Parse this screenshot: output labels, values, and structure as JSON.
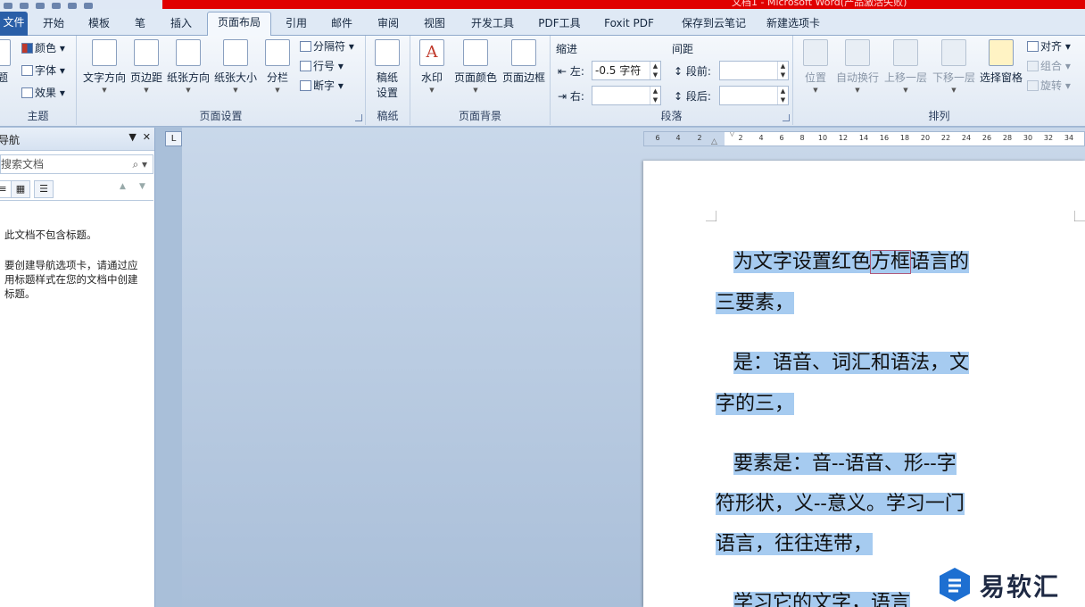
{
  "window": {
    "title": "文档1 - Microsoft Word(产品激活失败)"
  },
  "tabs": [
    {
      "label": "文件"
    },
    {
      "label": "开始"
    },
    {
      "label": "模板"
    },
    {
      "label": "笔"
    },
    {
      "label": "插入"
    },
    {
      "label": "页面布局"
    },
    {
      "label": "引用"
    },
    {
      "label": "邮件"
    },
    {
      "label": "审阅"
    },
    {
      "label": "视图"
    },
    {
      "label": "开发工具"
    },
    {
      "label": "PDF工具"
    },
    {
      "label": "Foxit PDF"
    },
    {
      "label": "保存到云笔记"
    },
    {
      "label": "新建选项卡"
    }
  ],
  "ribbon": {
    "theme": {
      "label": "主题",
      "theme_btn": "题",
      "colors": "颜色",
      "fonts": "字体",
      "effects": "效果"
    },
    "page_setup": {
      "label": "页面设置",
      "text_direction": "文字方向",
      "margins": "页边距",
      "orientation": "纸张方向",
      "size": "纸张大小",
      "columns": "分栏",
      "breaks": "分隔符",
      "line_numbers": "行号",
      "hyphenation": "断字"
    },
    "manuscript": {
      "label": "稿纸",
      "setup_line1": "稿纸",
      "setup_line2": "设置"
    },
    "page_background": {
      "label": "页面背景",
      "watermark": "水印",
      "page_color": "页面颜色",
      "page_borders": "页面边框"
    },
    "paragraph": {
      "label": "段落",
      "indent_title": "缩进",
      "spacing_title": "间距",
      "indent_left_label": "左:",
      "indent_left_value": "-0.5 字符",
      "indent_right_label": "右:",
      "indent_right_value": "",
      "spacing_before_label": "段前:",
      "spacing_before_value": "",
      "spacing_after_label": "段后:",
      "spacing_after_value": ""
    },
    "arrange": {
      "label": "排列",
      "position": "位置",
      "wrap_text": "自动换行",
      "bring_forward": "上移一层",
      "send_backward": "下移一层",
      "selection_pane": "选择窗格",
      "align": "对齐",
      "group": "组合",
      "rotate": "旋转"
    }
  },
  "nav_pane": {
    "title": "导航",
    "search_placeholder": "搜索文档",
    "empty_line1": "此文档不包含标题。",
    "empty_line2": "要创建导航选项卡，请通过应用标题样式在您的文档中创建标题。"
  },
  "ruler": {
    "ticks": [
      "6",
      "4",
      "2",
      "2",
      "4",
      "6",
      "8",
      "10",
      "12",
      "14",
      "16",
      "18",
      "20",
      "22",
      "24",
      "26",
      "28",
      "30",
      "32",
      "34"
    ]
  },
  "document": {
    "lines": [
      {
        "pre": "为文字设置红色",
        "boxed": "方框",
        "post": "语言的"
      },
      {
        "text": "三要素，"
      },
      {
        "text": "是：语音、词汇和语法，文"
      },
      {
        "text": "字的三，"
      },
      {
        "text": "要素是：音--语音、形--字"
      },
      {
        "text": "符形状，义--意义。学习一门"
      },
      {
        "text": "语言，往往连带，"
      },
      {
        "text": "学习它的文字，语言"
      }
    ]
  },
  "watermark": {
    "brand": "易软汇",
    "brand_color": "#1d6fd1"
  }
}
